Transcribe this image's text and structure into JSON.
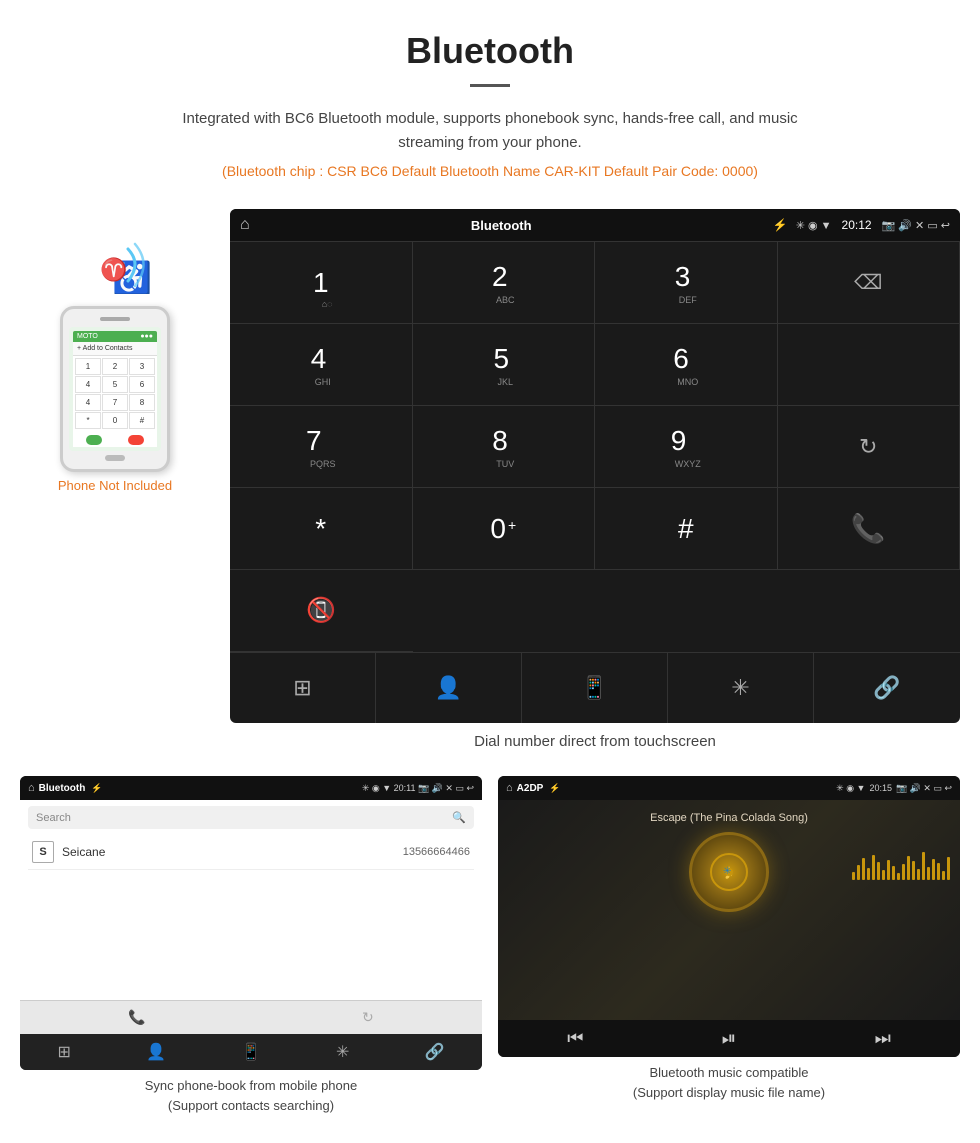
{
  "header": {
    "title": "Bluetooth",
    "description": "Integrated with BC6 Bluetooth module, supports phonebook sync, hands-free call, and music streaming from your phone.",
    "specs": "(Bluetooth chip : CSR BC6    Default Bluetooth Name CAR-KIT    Default Pair Code: 0000)"
  },
  "phone_label": "Phone Not Included",
  "dial_screen": {
    "statusbar": {
      "home_icon": "⌂",
      "title": "Bluetooth",
      "usb_icon": "⚡",
      "time": "20:12"
    },
    "keys": [
      {
        "num": "1",
        "sub": ""
      },
      {
        "num": "2",
        "sub": "ABC"
      },
      {
        "num": "3",
        "sub": "DEF"
      },
      {
        "num": "backspace",
        "sub": ""
      },
      {
        "num": "4",
        "sub": "GHI"
      },
      {
        "num": "5",
        "sub": "JKL"
      },
      {
        "num": "6",
        "sub": "MNO"
      },
      {
        "num": "",
        "sub": ""
      },
      {
        "num": "7",
        "sub": "PQRS"
      },
      {
        "num": "8",
        "sub": "TUV"
      },
      {
        "num": "9",
        "sub": "WXYZ"
      },
      {
        "num": "refresh",
        "sub": ""
      },
      {
        "num": "*",
        "sub": ""
      },
      {
        "num": "0+",
        "sub": ""
      },
      {
        "num": "#",
        "sub": ""
      },
      {
        "num": "call_green",
        "sub": ""
      },
      {
        "num": "call_red",
        "sub": ""
      }
    ],
    "bottom_icons": [
      "grid",
      "person",
      "phone",
      "bluetooth",
      "link"
    ]
  },
  "dial_caption": "Dial number direct from touchscreen",
  "phonebook_screen": {
    "statusbar_title": "Bluetooth",
    "search_placeholder": "Search",
    "contacts": [
      {
        "letter": "S",
        "name": "Seicane",
        "number": "13566664466"
      }
    ],
    "bottom_icons": [
      "grid",
      "person",
      "phone",
      "bluetooth",
      "link"
    ]
  },
  "phonebook_caption": "Sync phone-book from mobile phone\n(Support contacts searching)",
  "music_screen": {
    "statusbar_title": "A2DP",
    "time": "20:15",
    "song_title": "Escape (The Pina Colada Song)"
  },
  "music_caption": "Bluetooth music compatible\n(Support display music file name)"
}
